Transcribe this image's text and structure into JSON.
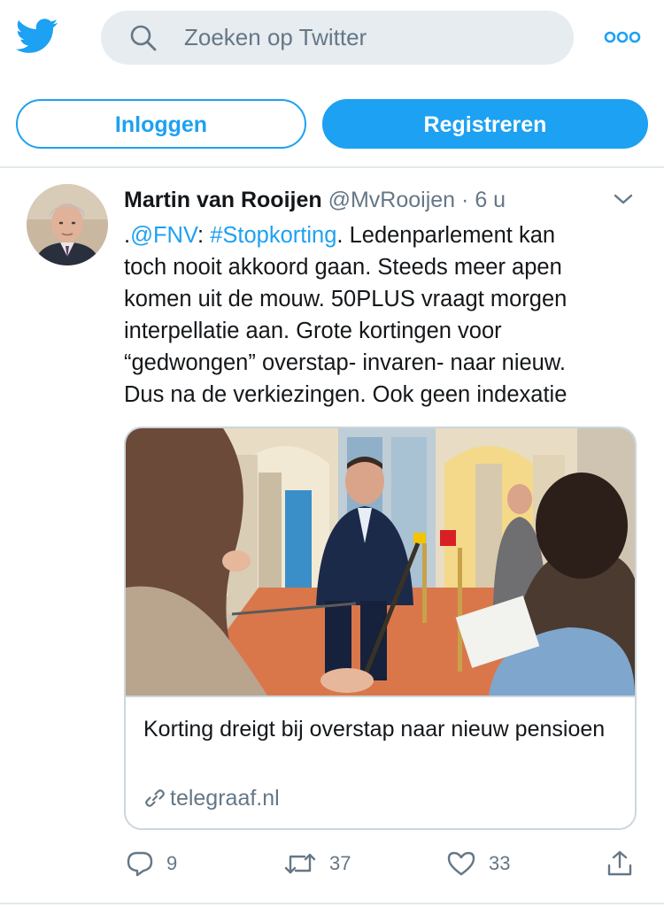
{
  "header": {
    "logo_icon": "twitter-bird-icon",
    "search_placeholder": "Zoeken op Twitter",
    "more_icon": "more-dots-icon"
  },
  "auth": {
    "login_label": "Inloggen",
    "register_label": "Registreren"
  },
  "tweet": {
    "author_name": "Martin van Rooijen",
    "author_handle": "@MvRooijen",
    "separator": "·",
    "time": "6 u",
    "text_lines": {
      "l1_prefix": ".",
      "l1_mention": "@FNV",
      "l1_colon": ": ",
      "l1_hashtag": "#Stopkorting",
      "l1_rest": ". Ledenparlement kan",
      "l2": "toch nooit akkoord gaan. Steeds meer apen",
      "l3": "komen uit de mouw. 50PLUS vraagt morgen",
      "l4": "interpellatie aan. Grote kortingen voor",
      "l5": "“gedwongen” overstap- invaren- naar nieuw.",
      "l6": "Dus na de verkiezingen. Ook  geen indexatie"
    },
    "card": {
      "title": "Korting dreigt bij overstap naar nieuw pensioen",
      "domain": "telegraaf.nl"
    },
    "actions": {
      "replies": "9",
      "retweets": "37",
      "likes": "33"
    }
  },
  "colors": {
    "accent": "#1da1f2",
    "muted": "#657786",
    "border": "#ccd6dd"
  }
}
